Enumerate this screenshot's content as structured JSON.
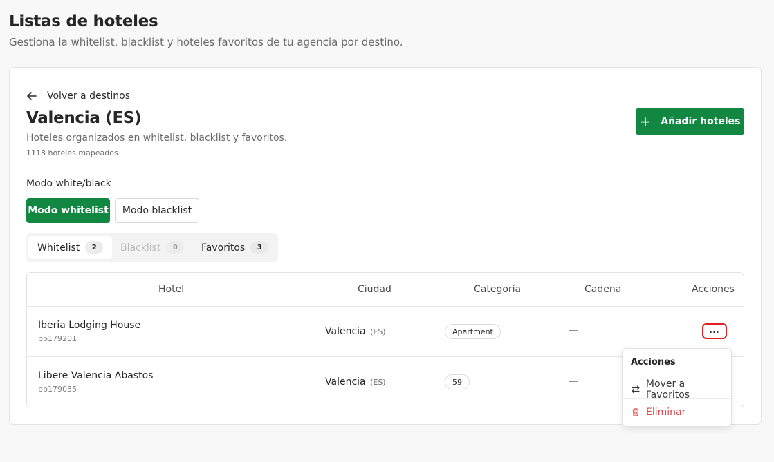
{
  "page": {
    "title": "Listas de hoteles",
    "subtitle": "Gestiona la whitelist, blacklist y hoteles favoritos de tu agencia por destino."
  },
  "destination": {
    "back_label": "Volver a destinos",
    "title": "Valencia (ES)",
    "description": "Hoteles organizados en whitelist, blacklist y favoritos.",
    "mapped_count": "1118 hoteles mapeados",
    "add_button_label": "Añadir hoteles",
    "add_button_icon": "plus-icon"
  },
  "mode": {
    "label": "Modo white/black",
    "whitelist_label": "Modo whitelist",
    "blacklist_label": "Modo blacklist",
    "active": "whitelist"
  },
  "tabs": [
    {
      "label": "Whitelist",
      "count": "2",
      "active": true
    },
    {
      "label": "Blacklist",
      "count": "0",
      "active": false
    },
    {
      "label": "Favoritos",
      "count": "3",
      "active": false
    }
  ],
  "table": {
    "columns": [
      "Hotel",
      "Ciudad",
      "Categoría",
      "Cadena",
      "Acciones"
    ],
    "rows": [
      {
        "name": "Iberia Lodging House",
        "id": "bb179201",
        "city": "Valencia",
        "country": "(ES)",
        "category": "Apartment",
        "chain": "—",
        "actions_icon": "ellipsis-icon"
      },
      {
        "name": "Libere Valencia Abastos",
        "id": "bb179035",
        "city": "Valencia",
        "country": "(ES)",
        "category": "59",
        "chain": "—"
      }
    ]
  },
  "actions_menu": {
    "title": "Acciones",
    "move_label": "Mover a Favoritos",
    "move_icon": "swap-arrows-icon",
    "delete_label": "Eliminar",
    "delete_icon": "trash-icon"
  },
  "colors": {
    "primary": "#118741",
    "danger": "#d94c4c",
    "focus_ring": "#e02020"
  }
}
